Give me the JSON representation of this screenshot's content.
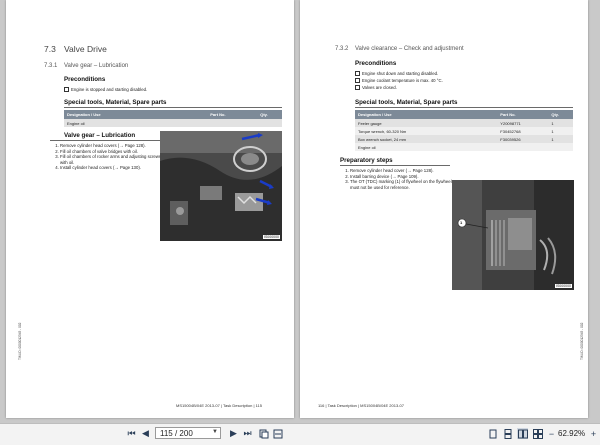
{
  "left_page": {
    "section_num": "7.3",
    "section_title": "Valve Drive",
    "sub_num": "7.3.1",
    "sub_title": "Valve gear – Lubrication",
    "preconditions_heading": "Preconditions",
    "preconditions": [
      "Engine is stopped and starting disabled."
    ],
    "tools_heading": "Special tools, Material, Spare parts",
    "table_headers": [
      "Designation / Use",
      "Part No.",
      "Qty."
    ],
    "table_rows": [
      [
        "Engine oil",
        "",
        ""
      ]
    ],
    "proc_heading": "Valve gear – Lubrication",
    "steps": [
      "Remove cylinder head covers (→ Page 128).",
      "Fill oil chambers of valve bridges with oil.",
      "Fill oil chambers of rocker arms and adjusting screws with oil.",
      "Install cylinder head covers (→ Page 130)."
    ],
    "photo_caption": "IS000000",
    "side_text": "TIM-ID: 0000012345 - 002",
    "footer": "MS15004B/04E 2013-07 | Task Description | 115"
  },
  "right_page": {
    "sub_num": "7.3.2",
    "sub_title": "Valve clearance – Check and adjustment",
    "preconditions_heading": "Preconditions",
    "preconditions": [
      "Engine shut down and starting disabled.",
      "Engine coolant temperature is max. 40 °C.",
      "Valves are closed."
    ],
    "tools_heading": "Special tools, Material, Spare parts",
    "table_headers": [
      "Designation / Use",
      "Part No.",
      "Qty."
    ],
    "table_rows": [
      [
        "Feeler gauge",
        "Y20098771",
        "1"
      ],
      [
        "Torque wrench, 60-320 Nm",
        "F30452768",
        "1"
      ],
      [
        "Box wrench socket, 24 mm",
        "F30039526",
        "1"
      ],
      [
        "Engine oil",
        "",
        ""
      ]
    ],
    "prep_heading": "Preparatory steps",
    "steps": [
      "Remove cylinder head cover (→ Page 128).",
      "Install barring device (→ Page 109).",
      "The OT (TDC) marking (1) of flywheel on the flywheel must not be used for reference."
    ],
    "photo_caption": "IS000000",
    "photo_label": "1",
    "side_text": "TIM-ID: 0000012345 - 002",
    "footer": "116 | Task Description | MS15004B/04E 2013-07"
  },
  "toolbar": {
    "page_value": "115 / 200",
    "zoom": "62.92%",
    "icons": [
      "first-page-icon",
      "prev-page-icon",
      "next-page-icon",
      "last-page-icon",
      "fit-page-icon",
      "fit-width-icon",
      "single-page-icon",
      "scroll-page-icon",
      "double-page-icon",
      "double-scroll-icon",
      "zoom-out-icon",
      "zoom-in-icon"
    ]
  }
}
